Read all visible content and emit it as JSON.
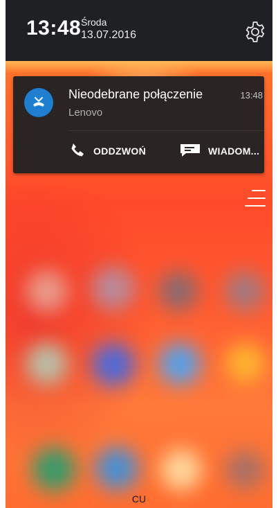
{
  "status": {
    "time": "13:48",
    "day": "Środa",
    "date": "13.07.2016"
  },
  "notification": {
    "title": "Nieodebrane połączenie",
    "subtitle": "Lenovo",
    "time": "13:48",
    "actions": {
      "call_label": "ODDZWOŃ",
      "message_label": "WIADOM..."
    }
  },
  "footer": {
    "label": "CU"
  },
  "colors": {
    "statusbar_bg": "#1f2023",
    "notification_bg": "#2a2523",
    "accent_blue": "#1e7fd0"
  },
  "icons": [
    "gear-icon",
    "missed-call-icon",
    "phone-icon",
    "message-icon",
    "menu-icon"
  ]
}
